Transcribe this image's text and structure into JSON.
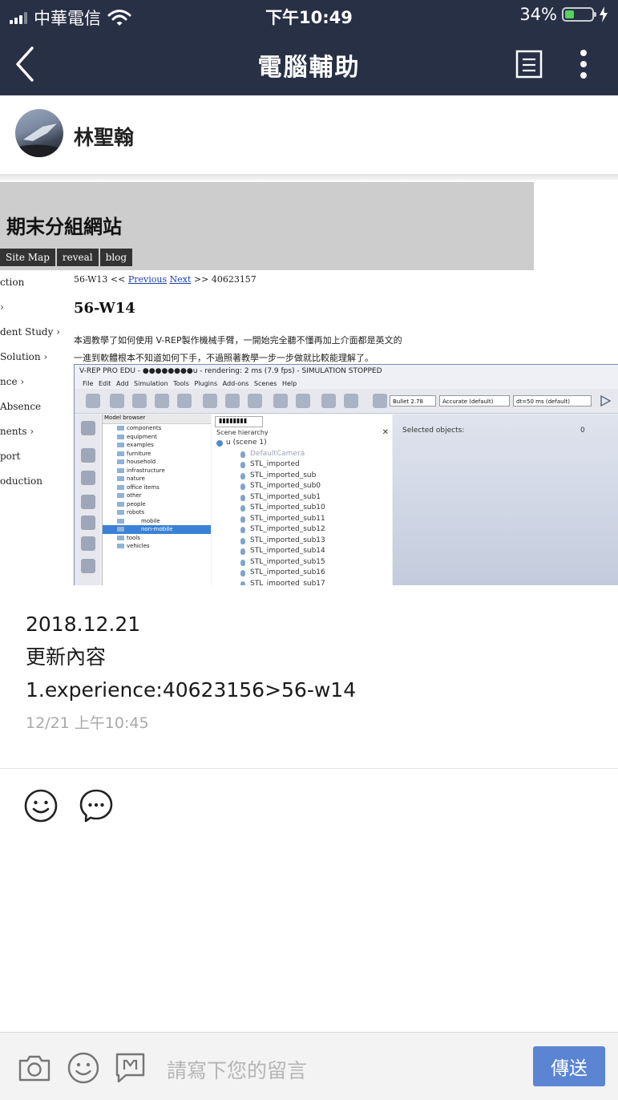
{
  "status_bar": {
    "carrier": "中華電信",
    "time": "下午10:49",
    "battery_percent": "34%",
    "battery_level": 0.34
  },
  "nav": {
    "title": "電腦輔助"
  },
  "author": {
    "name": "林聖翰"
  },
  "post_image": {
    "site_title": "期末分組網站",
    "tabs": [
      "Site Map",
      "reveal",
      "blog"
    ],
    "side_nav": [
      "ction",
      "›",
      "dent Study ›",
      "Solution ›",
      "nce ›",
      "Absence",
      "nents ›",
      "port",
      "oduction"
    ],
    "breadcrumb": {
      "prefix": "56-W13 <<",
      "previous": "Previous",
      "next": "Next",
      "suffix": ">> 40623157"
    },
    "heading": "56-W14",
    "lines": [
      "本週教學了如何使用 V-REP製作機械手臂，一開始完全聽不懂再加上介面都是英文的",
      "一進到軟體根本不知道如何下手，不過照著教學一步一步做就比較能理解了。"
    ],
    "vrep": {
      "window_title": "V-REP PRO EDU - ●●●●●●●●u - rendering: 2 ms (7.9 fps) - SIMULATION STOPPED",
      "menu": [
        "File",
        "Edit",
        "Add",
        "Simulation",
        "Tools",
        "Plugins",
        "Add-ons",
        "Scenes",
        "Help"
      ],
      "dropdowns": [
        "Bullet 2.78",
        "Accurate (default)",
        "dt=50 ms (default)"
      ],
      "model_browser_header": "Model browser",
      "model_browser_items": [
        "components",
        "equipment",
        "examples",
        "furniture",
        "household",
        "infrastructure",
        "nature",
        "office items",
        "other",
        "people",
        "robots",
        "mobile",
        "non-mobile",
        "tools",
        "vehicles"
      ],
      "scene_tab": "▮▮▮▮▮▮▮▮",
      "scene_header": "Scene hierarchy",
      "scene_items": [
        "u (scene 1)",
        "DefaultCamera",
        "STL_imported",
        "STL_imported_sub",
        "STL_imported_sub0",
        "STL_imported_sub1",
        "STL_imported_sub10",
        "STL_imported_sub11",
        "STL_imported_sub12",
        "STL_imported_sub13",
        "STL_imported_sub14",
        "STL_imported_sub15",
        "STL_imported_sub16",
        "STL_imported_sub17"
      ],
      "selected_label": "Selected objects:",
      "selected_count": "0"
    }
  },
  "post": {
    "lines": [
      "2018.12.21",
      "更新內容",
      "1.experience:40623156>56-w14"
    ],
    "timestamp": "12/21 上午10:45"
  },
  "comment_bar": {
    "placeholder": "請寫下您的留言",
    "send_label": "傳送"
  }
}
